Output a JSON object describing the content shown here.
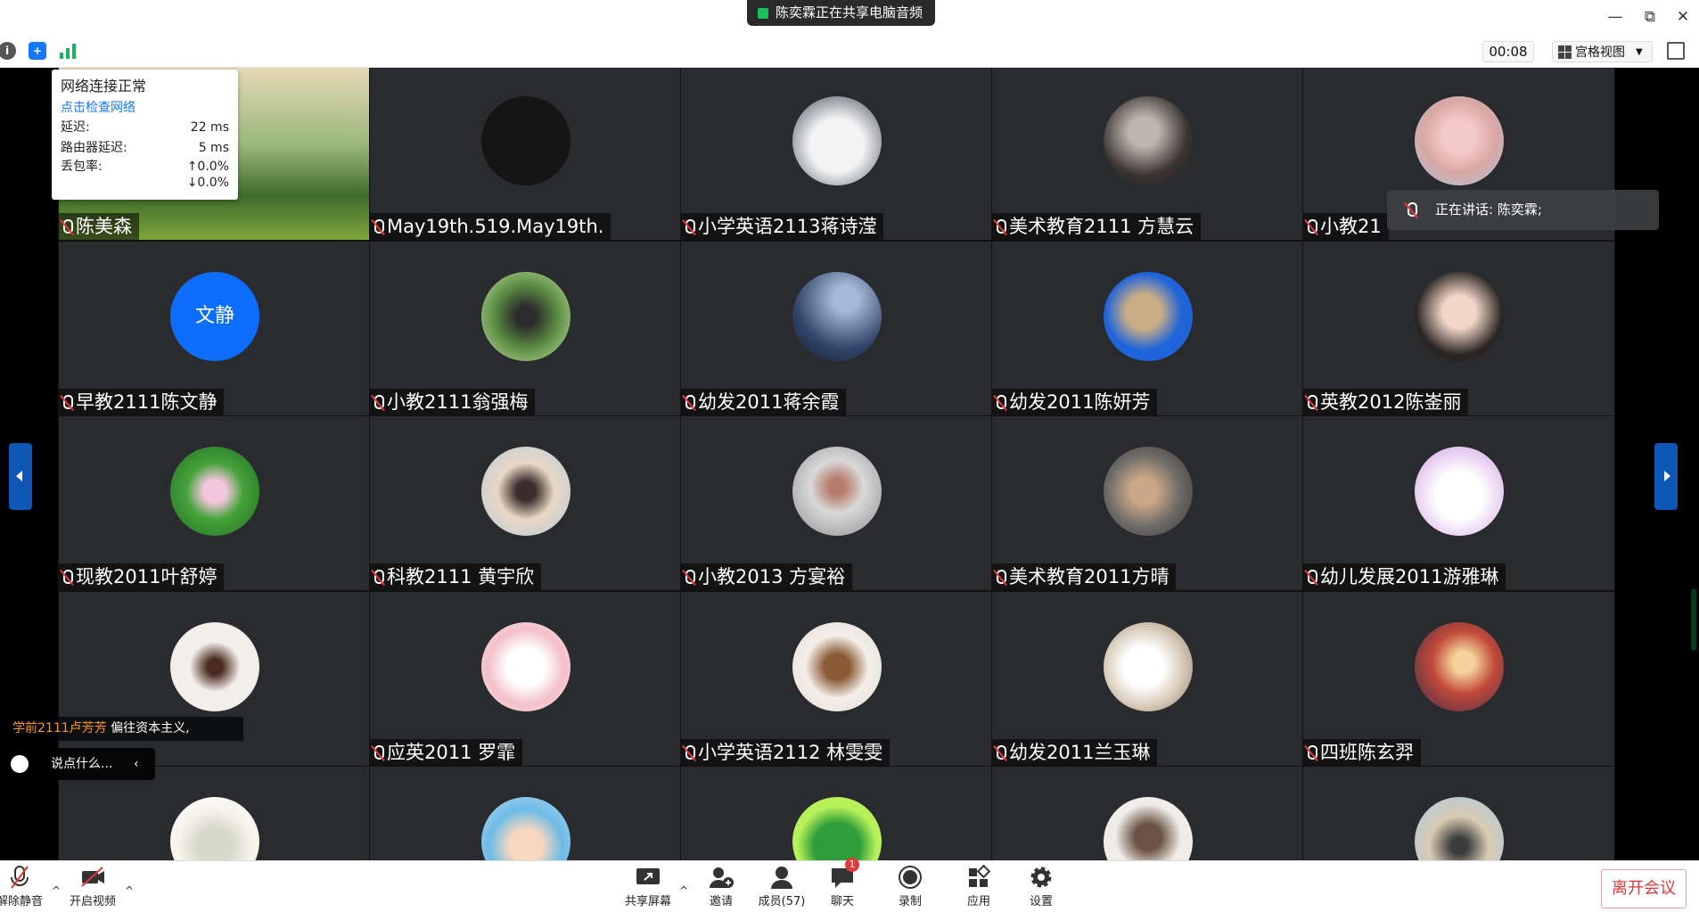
{
  "share_banner": "陈奕霖正在共享电脑音频",
  "window": {
    "minimize": "—",
    "restore": "⧉",
    "close": "✕"
  },
  "toolbar": {
    "timer": "00:08",
    "grid_view": "宫格视图"
  },
  "network_popup": {
    "title": "网络连接正常",
    "check_link": "点击检查网络",
    "latency_label": "延迟:",
    "latency_value": "22 ms",
    "router_label": "路由器延迟:",
    "router_value": "5 ms",
    "loss_label": "丢包率:",
    "loss_up": "↑0.0%",
    "loss_down": "↓0.0%"
  },
  "speaking": "正在讲话: 陈奕霖;",
  "participants": [
    {
      "name": "陈美森",
      "avatar": "landscape"
    },
    {
      "name": "May19th.519.May19th.",
      "avatar": "dark"
    },
    {
      "name": "小学英语2113蒋诗滢",
      "avatar": "cat"
    },
    {
      "name": "美术教育2111 方慧云",
      "avatar": "portrait-dark"
    },
    {
      "name": "小教21",
      "avatar": "portrait-pink"
    },
    {
      "name": "早教2111陈文静",
      "avatar": "text",
      "avatar_text": "文静"
    },
    {
      "name": "小教2111翁强梅",
      "avatar": "nature"
    },
    {
      "name": "幼发2011蒋余霞",
      "avatar": "night"
    },
    {
      "name": "幼发2011陈妍芳",
      "avatar": "bear-blue"
    },
    {
      "name": "英教2012陈崟丽",
      "avatar": "girl"
    },
    {
      "name": "现教2011叶舒婷",
      "avatar": "lotus"
    },
    {
      "name": "科教2111 黄宇欣",
      "avatar": "girl-light"
    },
    {
      "name": "小教2013 方宴裕",
      "avatar": "cat-hat"
    },
    {
      "name": "美术教育2011方晴",
      "avatar": "couple"
    },
    {
      "name": "幼儿发展2011游雅琳",
      "avatar": "bunny"
    },
    {
      "name": "",
      "avatar": "dancer"
    },
    {
      "name": "应英2011 罗霏",
      "avatar": "melody"
    },
    {
      "name": "小学英语2112 林雯雯",
      "avatar": "dog-plush"
    },
    {
      "name": "幼发2011兰玉琳",
      "avatar": "dog-white"
    },
    {
      "name": "四班陈玄羿",
      "avatar": "anime"
    },
    {
      "name": "",
      "avatar": "flowers"
    },
    {
      "name": "",
      "avatar": "cartoon-boy"
    },
    {
      "name": "",
      "avatar": "frog"
    },
    {
      "name": "",
      "avatar": "dog-man"
    },
    {
      "name": "",
      "avatar": "beach"
    }
  ],
  "chat": {
    "sender": "学前2111卢芳芳",
    "message": "偏往资本主义,",
    "input_placeholder": "说点什么..."
  },
  "bottom": {
    "unmute": "解除静音",
    "video": "开启视频",
    "share": "共享屏幕",
    "invite": "邀请",
    "members": "成员(57)",
    "chat": "聊天",
    "chat_badge": "1",
    "record": "录制",
    "apps": "应用",
    "settings": "设置",
    "leave": "离开会议"
  },
  "colors": {
    "accent": "#0d6efd",
    "danger": "#d93a3a",
    "tile_bg": "#2a2b2e"
  }
}
